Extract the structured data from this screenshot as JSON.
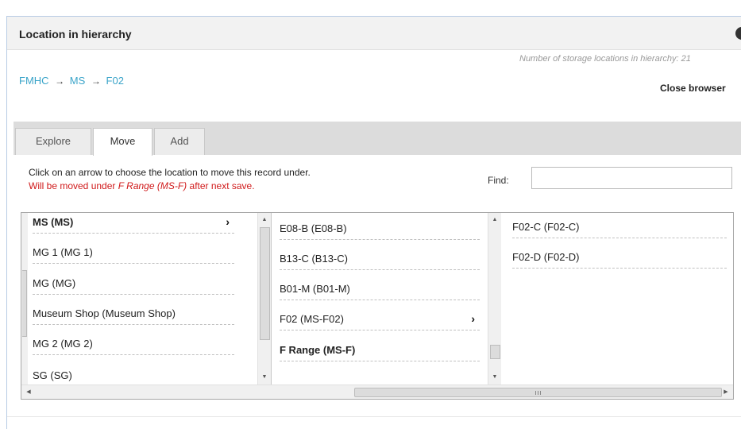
{
  "header": {
    "title": "Location in hierarchy",
    "icon": "info-icon"
  },
  "breadcrumb": {
    "items": [
      "FMHC",
      "MS",
      "F02"
    ],
    "separator": "→"
  },
  "storage_count": "Number of storage locations in hierarchy: 21",
  "close_label": "Close browser",
  "tabs": [
    {
      "label": "Explore",
      "active": false
    },
    {
      "label": "Move",
      "active": true
    },
    {
      "label": "Add",
      "active": false
    }
  ],
  "instructions": "Click on an arrow to choose the location to move this record under.",
  "moved_notice": {
    "prefix": "Will be moved under ",
    "target": "F Range (MS-F)",
    "suffix": " after next save."
  },
  "find": {
    "label": "Find:",
    "value": "",
    "placeholder": ""
  },
  "columns": [
    {
      "items": [
        {
          "label": "MS (MS)",
          "bold": true,
          "has_arrow": true
        },
        {
          "label": "MG 1 (MG 1)",
          "bold": false,
          "has_arrow": false
        },
        {
          "label": "MG (MG)",
          "bold": false,
          "has_arrow": false
        },
        {
          "label": "Museum Shop (Museum Shop)",
          "bold": false,
          "has_arrow": false
        },
        {
          "label": "MG 2 (MG 2)",
          "bold": false,
          "has_arrow": false
        },
        {
          "label": "SG (SG)",
          "bold": false,
          "has_arrow": false
        }
      ]
    },
    {
      "items": [
        {
          "label": "E08-B (E08-B)",
          "bold": false,
          "has_arrow": false
        },
        {
          "label": "B13-C (B13-C)",
          "bold": false,
          "has_arrow": false
        },
        {
          "label": "B01-M (B01-M)",
          "bold": false,
          "has_arrow": false
        },
        {
          "label": "F02 (MS-F02)",
          "bold": false,
          "has_arrow": true
        },
        {
          "label": "F Range (MS-F)",
          "bold": true,
          "has_arrow": false
        }
      ]
    },
    {
      "items": [
        {
          "label": "F02-C (F02-C)",
          "bold": false,
          "has_arrow": false
        },
        {
          "label": "F02-D (F02-D)",
          "bold": false,
          "has_arrow": false
        }
      ]
    }
  ],
  "scroll_arrow_glyphs": {
    "up": "▲",
    "down": "▼",
    "left": "◀",
    "right": "▶"
  },
  "chevron_glyph": "›",
  "colors": {
    "link": "#3aa4c9",
    "warning": "#d0191a",
    "header_bg": "#f2f2f2",
    "tab_band": "#dcdcdc"
  }
}
